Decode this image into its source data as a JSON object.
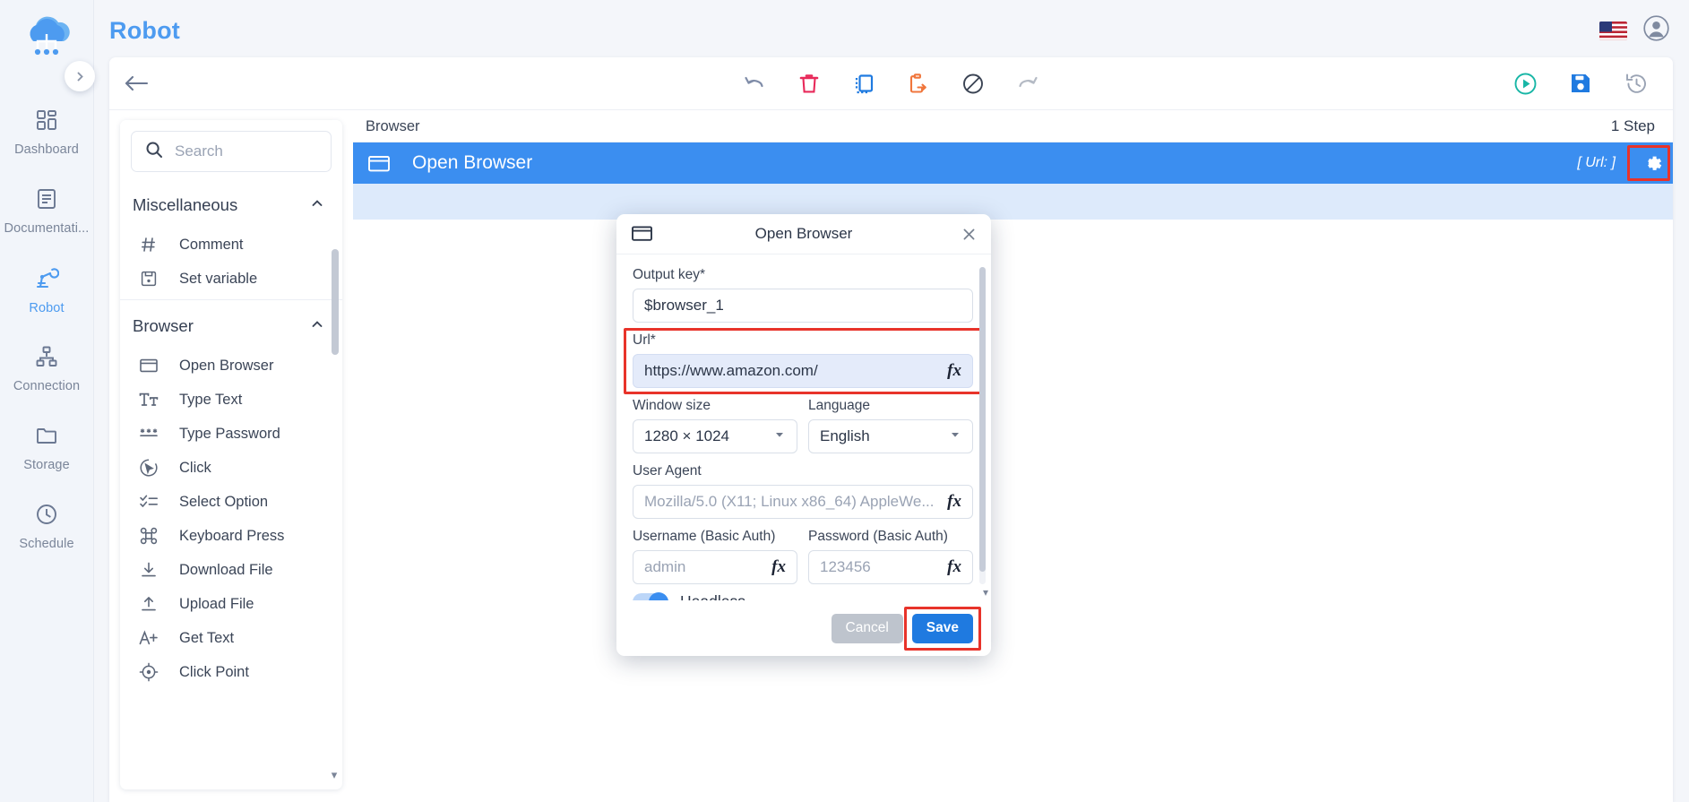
{
  "app": {
    "title": "Robot"
  },
  "sidebar": {
    "logo_name": "cloud-robot-logo",
    "expand_label": "›",
    "items": [
      {
        "label": "Dashboard",
        "icon": "dashboard-icon",
        "active": false
      },
      {
        "label": "Documentati...",
        "icon": "document-icon",
        "active": false
      },
      {
        "label": "Robot",
        "icon": "robot-arm-icon",
        "active": true
      },
      {
        "label": "Connection",
        "icon": "connection-icon",
        "active": false
      },
      {
        "label": "Storage",
        "icon": "folder-icon",
        "active": false
      },
      {
        "label": "Schedule",
        "icon": "clock-icon",
        "active": false
      }
    ]
  },
  "topbar": {
    "flag": "us-flag-icon",
    "account": "account-avatar-icon"
  },
  "toolbar": {
    "back": "back-arrow-icon",
    "center_buttons": [
      {
        "name": "undo-button",
        "icon": "undo-icon",
        "color": "#7f8ca8"
      },
      {
        "name": "delete-button",
        "icon": "trash-icon",
        "color": "#e8295a"
      },
      {
        "name": "copy-button",
        "icon": "copy-icon",
        "color": "#1f7ae0"
      },
      {
        "name": "paste-button",
        "icon": "paste-icon",
        "color": "#f0763c"
      },
      {
        "name": "disable-button",
        "icon": "no-entry-icon",
        "color": "#3a4353"
      },
      {
        "name": "redo-button",
        "icon": "redo-icon",
        "color": "#b4bac4"
      }
    ],
    "right_buttons": [
      {
        "name": "run-button",
        "icon": "play-circle-icon",
        "color": "#18b6a6"
      },
      {
        "name": "save-button",
        "icon": "floppy-disk-icon",
        "color": "#1f7ae0"
      },
      {
        "name": "history-button",
        "icon": "history-icon",
        "color": "#9aa3b4"
      }
    ]
  },
  "palette": {
    "search": {
      "placeholder": "Search",
      "value": ""
    },
    "groups": [
      {
        "title": "Miscellaneous",
        "collapse_icon": "chevron-up-icon",
        "items": [
          {
            "label": "Comment",
            "icon": "hash-icon"
          },
          {
            "label": "Set variable",
            "icon": "save-variable-icon"
          }
        ]
      },
      {
        "title": "Browser",
        "collapse_icon": "chevron-up-icon",
        "items": [
          {
            "label": "Open Browser",
            "icon": "browser-window-icon"
          },
          {
            "label": "Type Text",
            "icon": "type-text-icon"
          },
          {
            "label": "Type Password",
            "icon": "asterisks-icon"
          },
          {
            "label": "Click",
            "icon": "click-cursor-icon"
          },
          {
            "label": "Select Option",
            "icon": "checklist-icon"
          },
          {
            "label": "Keyboard Press",
            "icon": "command-key-icon"
          },
          {
            "label": "Download File",
            "icon": "download-icon"
          },
          {
            "label": "Upload File",
            "icon": "upload-icon"
          },
          {
            "label": "Get Text",
            "icon": "a-plus-icon"
          },
          {
            "label": "Click Point",
            "icon": "target-icon"
          }
        ]
      }
    ],
    "scroll_down": "▾"
  },
  "canvas": {
    "header_left": "Browser",
    "header_right": "1 Step",
    "step": {
      "name": "Open Browser",
      "icon": "browser-window-icon",
      "meta": "[ Url: ]",
      "gear_icon": "gear-icon"
    }
  },
  "modal": {
    "title": "Open Browser",
    "icon": "browser-window-icon",
    "close_icon": "close-icon",
    "fields": {
      "output_key": {
        "label": "Output key*",
        "value": "$browser_1"
      },
      "url": {
        "label": "Url*",
        "value": "https://www.amazon.com/",
        "fx": "fx"
      },
      "window_size": {
        "label": "Window size",
        "value": "1280 × 1024",
        "arrow": "▾"
      },
      "language": {
        "label": "Language",
        "value": "English",
        "arrow": "▾"
      },
      "user_agent": {
        "label": "User Agent",
        "placeholder": "Mozilla/5.0 (X11; Linux x86_64) AppleWe...",
        "fx": "fx"
      },
      "username": {
        "label": "Username (Basic Auth)",
        "placeholder": "admin",
        "fx": "fx"
      },
      "password": {
        "label": "Password (Basic Auth)",
        "placeholder": "123456",
        "fx": "fx"
      },
      "headless": {
        "label": "Headless",
        "on": true
      }
    },
    "buttons": {
      "cancel": "Cancel",
      "save": "Save"
    },
    "scroll_down": "▾"
  },
  "colors": {
    "accent": "#4d9bf0",
    "step_row": "#3b8ef0",
    "step_body": "#ddeafb",
    "highlight": "#e8332a",
    "save_button": "#1f7ae0",
    "cancel_button": "#bec4cd"
  }
}
